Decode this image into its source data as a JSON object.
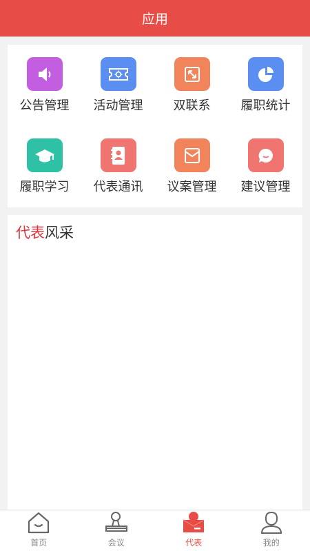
{
  "header": {
    "title": "应用"
  },
  "apps": [
    {
      "label": "公告管理",
      "icon": "speaker-icon",
      "color": "#c45ee0"
    },
    {
      "label": "活动管理",
      "icon": "ticket-icon",
      "color": "#5a8ef0"
    },
    {
      "label": "双联系",
      "icon": "link-arrows-icon",
      "color": "#f2845c"
    },
    {
      "label": "履职统计",
      "icon": "pie-chart-icon",
      "color": "#5a8ef0"
    },
    {
      "label": "履职学习",
      "icon": "graduation-cap-icon",
      "color": "#2fc1a6"
    },
    {
      "label": "代表通讯",
      "icon": "contact-book-icon",
      "color": "#f07470"
    },
    {
      "label": "议案管理",
      "icon": "envelope-icon",
      "color": "#f2845c"
    },
    {
      "label": "建议管理",
      "icon": "chat-bubble-icon",
      "color": "#f07470"
    }
  ],
  "section": {
    "title_highlight": "代表",
    "title_rest": "风采"
  },
  "tabbar": {
    "items": [
      {
        "label": "首页",
        "icon": "home-icon"
      },
      {
        "label": "会议",
        "icon": "meeting-icon"
      },
      {
        "label": "代表",
        "icon": "representative-icon",
        "active": true
      },
      {
        "label": "我的",
        "icon": "profile-icon"
      }
    ],
    "active_color": "#e84c46"
  }
}
